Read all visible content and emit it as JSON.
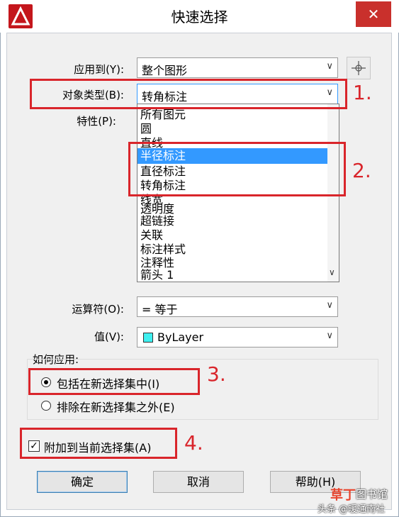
{
  "window": {
    "title": "快速选择",
    "close_glyph": "✕"
  },
  "fields": {
    "apply_to_label": "应用到(Y):",
    "apply_to_value": "整个图形",
    "object_type_label": "对象类型(B):",
    "object_type_value": "转角标注",
    "properties_label": "特性(P):",
    "operator_label": "运算符(O):",
    "operator_value": "= 等于",
    "value_label": "值(V):",
    "value_value": "ByLayer"
  },
  "dropdown": {
    "items": [
      {
        "label": "所有图元",
        "selected": false
      },
      {
        "label": "圆",
        "selected": false
      },
      {
        "label": "直线",
        "selected": false
      },
      {
        "label": "半径标注",
        "selected": true
      },
      {
        "label": "直径标注",
        "selected": false
      },
      {
        "label": "转角标注",
        "selected": false
      },
      {
        "label": "线宽",
        "selected": false
      },
      {
        "label": "透明度",
        "selected": false
      },
      {
        "label": "超链接",
        "selected": false
      },
      {
        "label": "关联",
        "selected": false
      },
      {
        "label": "标注样式",
        "selected": false
      },
      {
        "label": "注释性",
        "selected": false
      },
      {
        "label": "箭头 1",
        "selected": false
      }
    ]
  },
  "apply_group": {
    "title": "如何应用:",
    "include_label": "包括在新选择集中(I)",
    "exclude_label": "排除在新选择集之外(E)"
  },
  "append_label": "附加到当前选择集(A)",
  "buttons": {
    "ok": "确定",
    "cancel": "取消",
    "help": "帮助(H)"
  },
  "annotations": {
    "a1": "1.",
    "a2": "2.",
    "a3": "3.",
    "a4": "4."
  },
  "watermark": {
    "logo": "草丁",
    "site": "图书馆",
    "credit": "头条 @暖通南社"
  },
  "colors": {
    "highlight": "#3399ff",
    "annotation_red": "#d9252b",
    "swatch": "#3ff0f0"
  },
  "icons": {
    "app": "autocad-logo-icon",
    "pick": "crosshair-icon",
    "dropdown": "chevron-down-icon"
  }
}
